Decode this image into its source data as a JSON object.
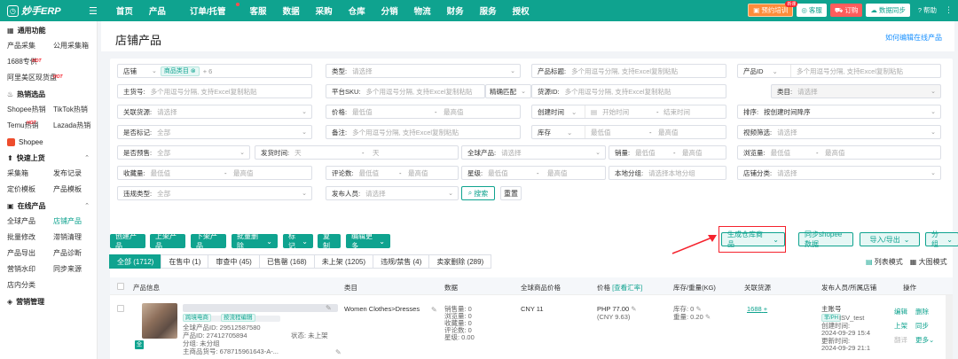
{
  "topbar": {
    "logo_text": "妙手ERP",
    "nav": [
      "首页",
      "产品",
      "订单/托管",
      "客服",
      "数据",
      "采购",
      "仓库",
      "分销",
      "物流",
      "财务",
      "服务",
      "授权"
    ],
    "training_label": "预约培训",
    "training_badge": "新课",
    "service_label": "客服",
    "order_label": "订购",
    "sync_label": "数据同步",
    "help_label": "帮助",
    "colors": {
      "brand": "#0fa38f",
      "orange": "#ff8c3a",
      "red": "#ff5c5c"
    }
  },
  "sidebar": {
    "sections": [
      {
        "title": "通用功能",
        "items": [
          "产品采集",
          "公用采集箱",
          "1688专供",
          "阿里美区现货盘"
        ]
      },
      {
        "title": "热销选品",
        "items": [
          "Shopee热销",
          "TikTok热销",
          "Temu热销",
          "Lazada热销"
        ]
      },
      {
        "title": "Shopee",
        "items": []
      },
      {
        "title": "快速上货",
        "items": [
          "采集箱",
          "发布记录",
          "定价模板",
          "产品模板"
        ]
      },
      {
        "title": "在线产品",
        "items": [
          "全球产品",
          "店铺产品",
          "批量修改",
          "滞销清理",
          "产品导出",
          "产品诊断",
          "营销水印",
          "同步来源",
          "店内分类"
        ]
      },
      {
        "title": "营销管理",
        "items": []
      }
    ],
    "hot_label": "HOT"
  },
  "page": {
    "title": "店铺产品",
    "help_link": "如何编辑在线产品"
  },
  "filters": {
    "shop": {
      "label": "店铺",
      "tag": "商品类目",
      "more": "+ 6"
    },
    "type": {
      "label": "类型:",
      "placeholder": "请选择"
    },
    "product_title": {
      "label": "产品标题:",
      "placeholder": "多个用逗号分隔, 支持Excel复制粘贴"
    },
    "product_id": {
      "label": "产品ID",
      "placeholder": "多个用逗号分隔, 支持Excel复制粘贴"
    },
    "sku_main": {
      "label": "主货号:",
      "placeholder": "多个用逗号分隔, 支持Excel复制粘贴"
    },
    "platform_sku": {
      "label": "平台SKU:",
      "placeholder": "多个用逗号分隔, 支持Excel复制粘贴"
    },
    "fuzzy_match": {
      "label": "精确匹配"
    },
    "source_id": {
      "label": "货源ID:",
      "placeholder": "多个用逗号分隔, 支持Excel复制粘贴"
    },
    "category": {
      "label": "类目:",
      "placeholder": "请选择"
    },
    "source_link": {
      "label": "关联货源:",
      "placeholder": "请选择"
    },
    "price": {
      "label": "价格:",
      "min": "最低值",
      "max": "最高值"
    },
    "create_time": {
      "label": "创建时间",
      "start": "开始时间",
      "end": "结束时间"
    },
    "sort": {
      "label": "排序:",
      "value": "按创建时间降序"
    },
    "tag_mark": {
      "label": "是否标记:",
      "value": "全部"
    },
    "remark": {
      "label": "备注:",
      "placeholder": "多个用逗号分隔, 支持Excel复制粘贴"
    },
    "stock": {
      "label": "库存",
      "min": "最低值",
      "max": "最高值"
    },
    "video": {
      "label": "视频筛选:",
      "placeholder": "请选择"
    },
    "presale": {
      "label": "是否预售:",
      "value": "全部"
    },
    "ship_time": {
      "label": "发货时间:",
      "min": "天",
      "max": "天"
    },
    "global_product": {
      "label": "全球产品:",
      "placeholder": "请选择"
    },
    "sales": {
      "label": "销量:",
      "min": "最低值",
      "max": "最高值"
    },
    "views": {
      "label": "浏览量:",
      "min": "最低值",
      "max": "最高值"
    },
    "favorites": {
      "label": "收藏量:",
      "min": "最低值",
      "max": "最高值"
    },
    "reviews": {
      "label": "评论数:",
      "min": "最低值",
      "max": "最高值"
    },
    "rating": {
      "label": "星级:",
      "min": "最低值",
      "max": "最高值"
    },
    "local_group": {
      "label": "本地分组:",
      "placeholder": "请选择本地分组"
    },
    "shop_cat": {
      "label": "店铺分类:",
      "placeholder": "请选择"
    },
    "violation": {
      "label": "违规类型:",
      "value": "全部"
    },
    "publisher": {
      "label": "发布人员:",
      "placeholder": "请选择"
    },
    "search_btn": "搜索",
    "reset_btn": "重置"
  },
  "toolbar": {
    "buttons": [
      "创建产品",
      "上架产品",
      "下架产品",
      "批量删除",
      "标记",
      "复制",
      "编辑更多"
    ],
    "gen_warehouse": "生成仓库商品",
    "sync_shopee": "同步shopee数据",
    "import_export": "导入/导出",
    "group": "分组",
    "list_mode": "列表模式",
    "grid_mode": "大图模式"
  },
  "tabs": [
    {
      "label": "全部 (1712)",
      "active": true
    },
    {
      "label": "在售中 (1)",
      "active": false
    },
    {
      "label": "审查中 (45)",
      "active": false
    },
    {
      "label": "已售罄 (168)",
      "active": false
    },
    {
      "label": "未上架 (1205)",
      "active": false
    },
    {
      "label": "违规/禁售 (4)",
      "active": false
    },
    {
      "label": "卖家删除 (289)",
      "active": false
    }
  ],
  "table": {
    "headers": {
      "info": "产品信息",
      "category": "类目",
      "data": "数据",
      "global_price": "全球商品价格",
      "price": "价格",
      "price_sub": "[查看汇率]",
      "stock_weight": "库存/重量(KG)",
      "source": "关联货源",
      "publisher": "发布人员/所属店铺",
      "ops": "操作"
    },
    "row": {
      "tags": [
        "跨境电商",
        "按流程编辑"
      ],
      "global_id": "全球产品ID: 29512587580",
      "product_id": "产品ID: 27412705894",
      "status": "状态: 未上架",
      "group": "分组: 未分组",
      "sku": "主商品货号: 678715961643-A-...",
      "global_mark": "全",
      "category": "Women Clothes>Dresses",
      "stats": [
        "销售量: 0",
        "浏览量: 0",
        "收藏量: 0",
        "评论数: 0",
        "星级: 0.00"
      ],
      "global_price": "CNY 11",
      "price": "PHP 77.00",
      "price_cny": "(CNY 9.63)",
      "stock": "库存: 0",
      "weight": "重量: 0.20",
      "source_link": "1688",
      "main_account": "主账号",
      "shop_region": "菲/PH",
      "shop_name": "ISV_test",
      "created": "创建时间:",
      "created_val": "2024-09-29 15:4",
      "updated": "更新时间:",
      "updated_val": "2024-09-29 21:1",
      "ops": [
        "编辑",
        "删除",
        "上架",
        "同步",
        "翻译",
        "更多"
      ]
    }
  }
}
